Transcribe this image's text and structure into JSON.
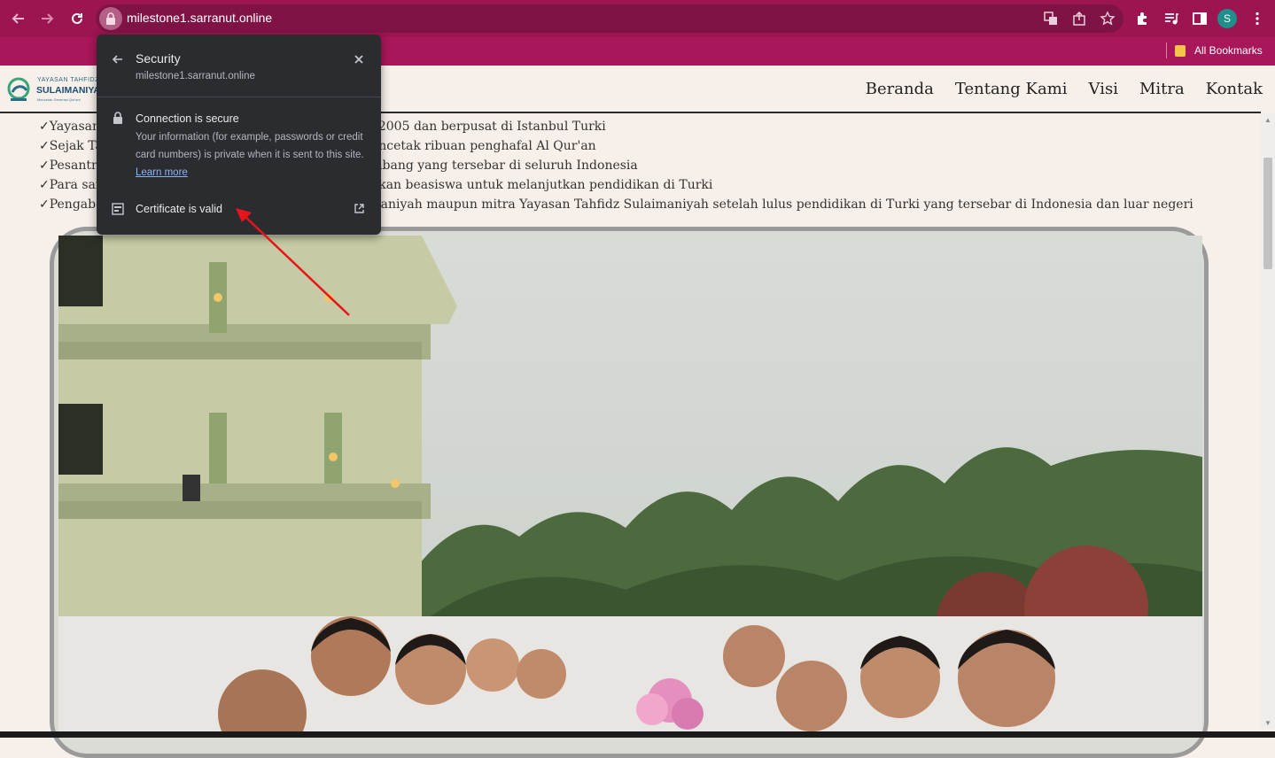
{
  "browser": {
    "url": "milestone1.sarranut.online",
    "profile_initial": "S",
    "bookmarks_label": "All Bookmarks",
    "icons": [
      "back-icon",
      "forward-icon",
      "reload-icon",
      "lock-icon",
      "translate-icon",
      "share-icon",
      "star-icon",
      "extensions-icon",
      "media-icon",
      "side-panel-icon",
      "menu-icon"
    ]
  },
  "security_popup": {
    "title": "Security",
    "domain": "milestone1.sarranut.online",
    "connection_heading": "Connection is secure",
    "connection_text": "Your information (for example, passwords or credit card numbers) is private when it is sent to this site.",
    "learn_more": "Learn more",
    "certificate_label": "Certificate is valid"
  },
  "site": {
    "logo": {
      "line1": "YAYASAN TAHFIDZ",
      "line2": "SULAIMANIYAH",
      "line3": "Mencetak Generasi Qur'ani"
    },
    "nav": [
      "Beranda",
      "Tentang Kami",
      "Visi",
      "Mitra",
      "Kontak"
    ],
    "check_items": [
      "✓Yayasan Tahfidz Sulaimaniyah didirikan pada tahun 2005 dan berpusat di Istanbul Turki",
      "✓Sejak Tahun 2005 Yayasan Tahfidz Sulaimaniyah mencetak ribuan penghafal Al Qur'an",
      "✓Pesantren Yayasan Tahfidz Sulaimaniyah memiliki cabang yang tersebar di seluruh Indonesia",
      "✓Para santri Yayasan Tahfidz Sulaimaniyah mendapatkan beasiswa untuk melanjutkan pendidikan di Turki",
      "✓Pengabdian santri di cabang Yayasan Tahfidz Sulaimaniyah maupun mitra Yayasan Tahfidz Sulaimaniyah setelah lulus pendidikan di Turki yang tersebar di Indonesia dan luar negeri"
    ]
  }
}
